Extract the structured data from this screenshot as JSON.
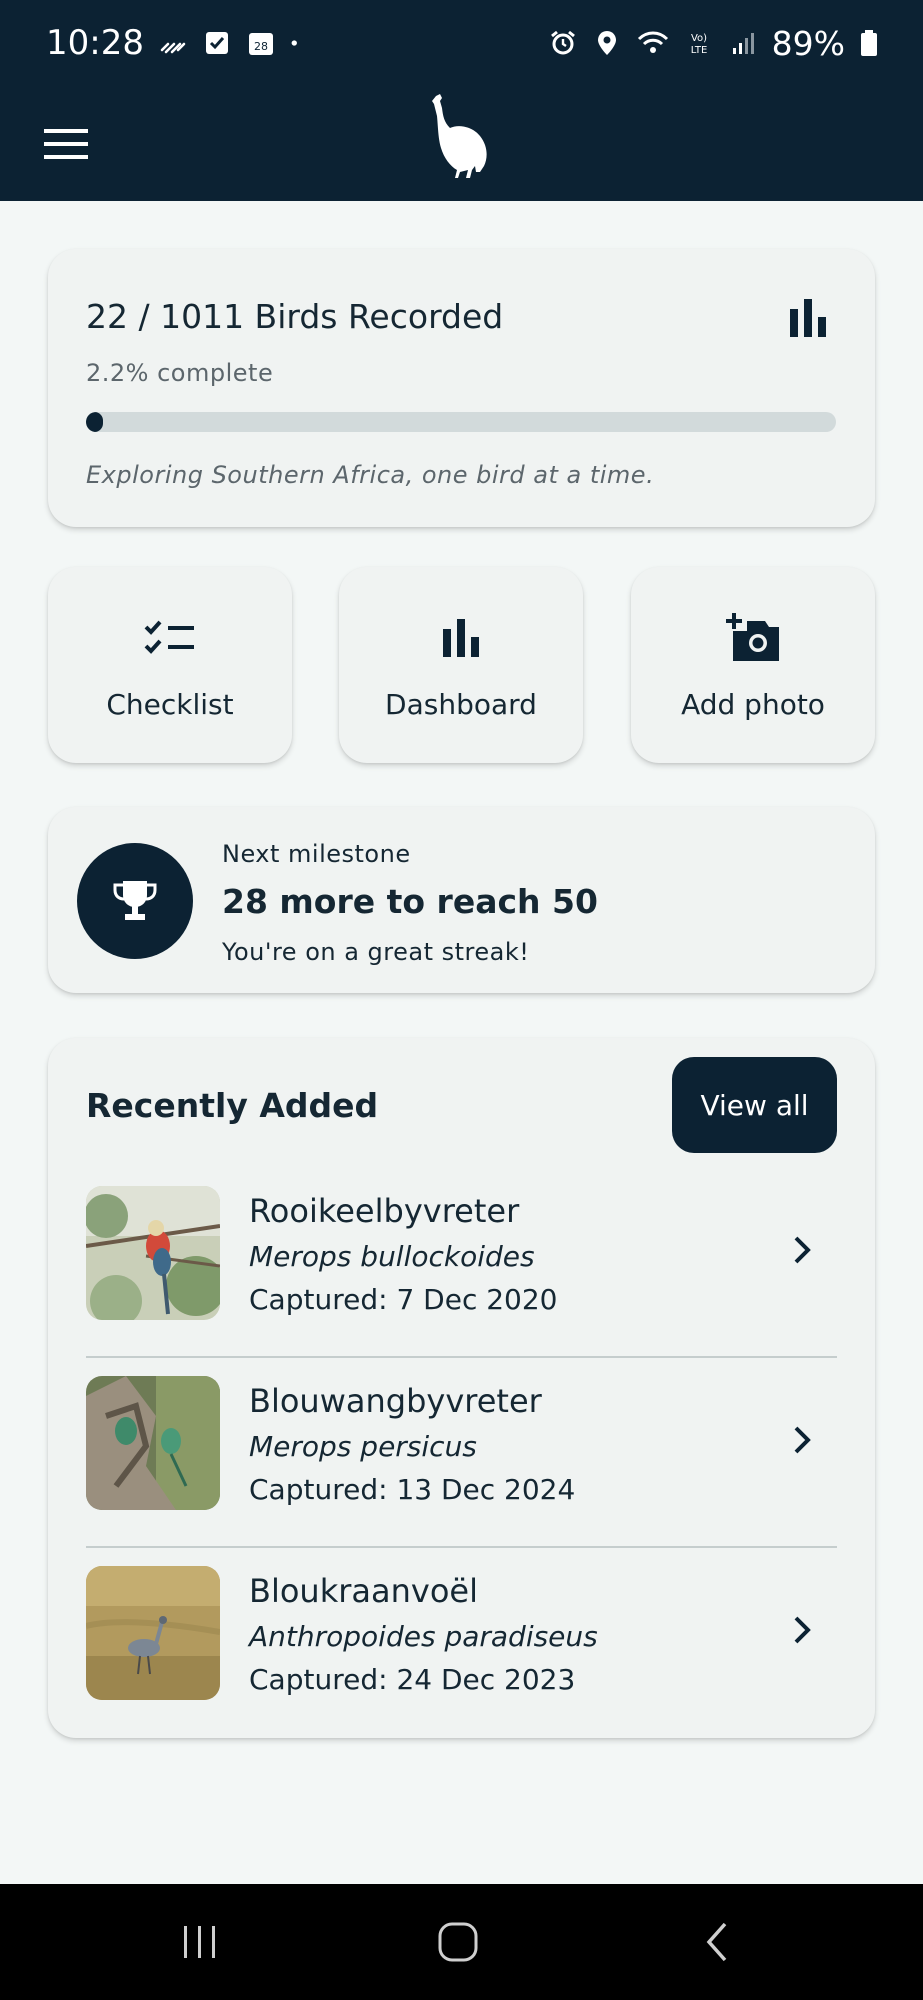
{
  "status_bar": {
    "time": "10:28",
    "battery": "89%",
    "calendar_date": "28",
    "icons": [
      "wifi-calling-icon",
      "checkbox-icon",
      "calendar-icon",
      "notification-dot-icon",
      "alarm-icon",
      "location-icon",
      "wifi-icon",
      "volte-icon",
      "signal-icon",
      "battery-icon"
    ]
  },
  "app_bar": {
    "menu_icon": "hamburger-menu-icon",
    "logo_icon": "guineafowl-logo-icon"
  },
  "progress": {
    "title": "22 / 1011 Birds Recorded",
    "percent_text": "2.2% complete",
    "fraction": 0.022,
    "tagline": "Exploring Southern Africa, one bird at a time.",
    "icon": "bar-chart-icon"
  },
  "actions": [
    {
      "label": "Checklist",
      "icon": "checklist-icon"
    },
    {
      "label": "Dashboard",
      "icon": "bar-chart-icon"
    },
    {
      "label": "Add photo",
      "icon": "add-photo-icon"
    }
  ],
  "milestone": {
    "label": "Next milestone",
    "title": "28 more to reach 50",
    "subtitle": "You're on a great streak!",
    "icon": "trophy-icon"
  },
  "recent": {
    "title": "Recently Added",
    "view_all_label": "View all",
    "items": [
      {
        "name": "Rooikeelbyvreter",
        "scientific": "Merops bullockoides",
        "captured": "Captured: 7 Dec 2020"
      },
      {
        "name": "Blouwangbyvreter",
        "scientific": "Merops persicus",
        "captured": "Captured: 13 Dec 2024"
      },
      {
        "name": "Bloukraanvoël",
        "scientific": "Anthropoides paradiseus",
        "captured": "Captured: 24 Dec 2023"
      }
    ]
  },
  "nav_bar": {
    "icons": [
      "recent-apps-icon",
      "home-icon",
      "back-icon"
    ]
  },
  "colors": {
    "primary": "#0c2233",
    "background": "#f3f7f6",
    "card": "#f0f3f2",
    "track": "#d2dadb"
  }
}
